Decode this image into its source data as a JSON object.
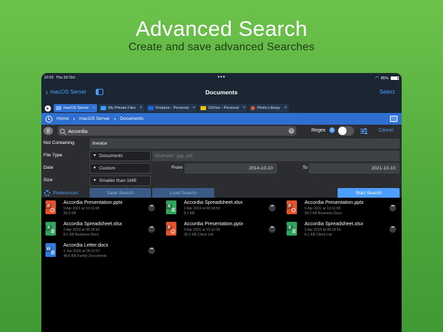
{
  "promo": {
    "title": "Advanced Search",
    "subtitle": "Create and save advanced Searches"
  },
  "statusbar": {
    "time": "10:01",
    "date": "Thu 10 Oct",
    "battery": "85%"
  },
  "navbar": {
    "back_label": "macOS Server",
    "title": "Documents",
    "select_label": "Select"
  },
  "tabs": [
    {
      "label": "macOS Server",
      "active": true,
      "color": "#7fb0ff"
    },
    {
      "label": "My Private Files",
      "active": false,
      "color": "#3da0ff"
    },
    {
      "label": "Dropbox - Personal",
      "active": false,
      "color": "#1e63e0"
    },
    {
      "label": "GDrive - Personal",
      "active": false,
      "color": "#f4c20d"
    },
    {
      "label": "Photo Library",
      "active": false,
      "color": "#e0563a"
    }
  ],
  "breadcrumb": [
    "Home",
    "macOS Server",
    "Documents"
  ],
  "search": {
    "query": "Accordia",
    "regex_label": "Regex",
    "cancel_label": "Cancel"
  },
  "form": {
    "not_containing_label": "Not Containing",
    "not_containing_value": "Invoice",
    "file_type_label": "File Type",
    "file_type_value": "Documents",
    "file_type_placeholder": "Example: .jpg,.pdf",
    "date_label": "Date",
    "date_value": "Custom",
    "from_label": "From",
    "from_value": "2014-10-10",
    "to_label": "To",
    "to_value": "2021-10-10",
    "size_label": "Size",
    "size_value": "Smaller than 1MB"
  },
  "actions": {
    "preferences": "Preferences",
    "save_search": "Save Search",
    "load_search": "Load Search",
    "start_search": "Start Search"
  },
  "files": [
    {
      "name": "Accordia Presentation.pptx",
      "date": "9 Apr 2021 at 10:11:08",
      "meta": "30.2 KB",
      "type": "ppt",
      "badge": "P"
    },
    {
      "name": "Accordia Spreadsheet.xlsx",
      "date": "2 Apr 2019 at 08:18:50",
      "meta": "8.1 KB",
      "type": "xls",
      "badge": "X"
    },
    {
      "name": "Accordia Presentation.pptx",
      "date": "9 Apr 2021 at 10:11:08",
      "meta": "30.2 KB  Business Docs",
      "type": "ppt",
      "badge": "P"
    },
    {
      "name": "Accordia Spreadsheet.xlsx",
      "date": "2 Apr 2019 at 08:18:50",
      "meta": "8.1 KB  Business Docs",
      "type": "xls",
      "badge": "X"
    },
    {
      "name": "Accordia Presentation.pptx",
      "date": "9 Apr 2021 at 10:11:08",
      "meta": "30.2 KB  Client List",
      "type": "ppt",
      "badge": "P"
    },
    {
      "name": "Accordia Spreadsheet.xlsx",
      "date": "2 Apr 2019 at 08:18:50",
      "meta": "8.1 KB  Client List",
      "type": "xls",
      "badge": "X"
    },
    {
      "name": "Accordia Letter.docx",
      "date": "1 Jun 2020 at 08:21:07",
      "meta": "48.6 KB  Family Documents",
      "type": "doc",
      "badge": "W"
    }
  ]
}
